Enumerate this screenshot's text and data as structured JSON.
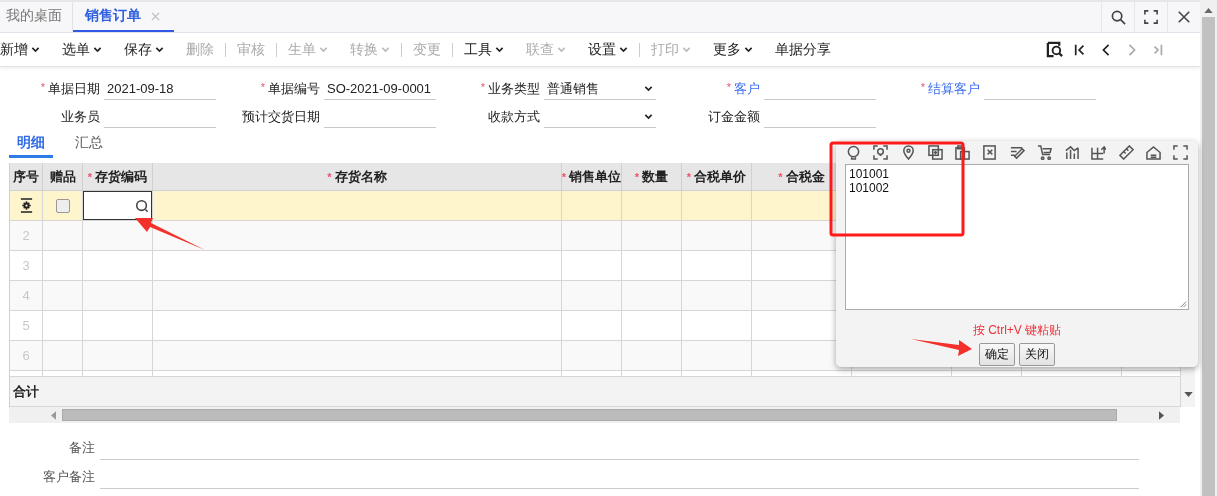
{
  "tabs": [
    {
      "label": "我的桌面",
      "selected": false
    },
    {
      "label": "销售订单",
      "selected": true
    }
  ],
  "toolbar": [
    {
      "label": "新增",
      "menu": true,
      "disabled": false,
      "sep_after": false
    },
    {
      "label": "选单",
      "menu": true,
      "disabled": false,
      "sep_after": false
    },
    {
      "label": "保存",
      "menu": true,
      "disabled": false,
      "sep_after": false
    },
    {
      "label": "删除",
      "menu": false,
      "disabled": true,
      "sep_after": true
    },
    {
      "label": "审核",
      "menu": false,
      "disabled": true,
      "sep_after": true
    },
    {
      "label": "生单",
      "menu": true,
      "disabled": true,
      "sep_after": false
    },
    {
      "label": "转换",
      "menu": true,
      "disabled": true,
      "sep_after": true
    },
    {
      "label": "变更",
      "menu": false,
      "disabled": true,
      "sep_after": true
    },
    {
      "label": "工具",
      "menu": true,
      "disabled": false,
      "sep_after": false
    },
    {
      "label": "联查",
      "menu": true,
      "disabled": true,
      "sep_after": false
    },
    {
      "label": "设置",
      "menu": true,
      "disabled": false,
      "sep_after": true
    },
    {
      "label": "打印",
      "menu": true,
      "disabled": true,
      "sep_after": false
    },
    {
      "label": "更多",
      "menu": true,
      "disabled": false,
      "sep_after": false
    },
    {
      "label": "单据分享",
      "menu": false,
      "disabled": false,
      "sep_after": false
    }
  ],
  "nav_buttons": [
    {
      "kind": "locate",
      "disabled": false
    },
    {
      "kind": "first",
      "disabled": false
    },
    {
      "kind": "prev",
      "disabled": false
    },
    {
      "kind": "next",
      "disabled": true
    },
    {
      "kind": "last",
      "disabled": true
    }
  ],
  "form_fields": [
    {
      "label": "单据日期",
      "required_mark": "*",
      "link": false,
      "kind": "text",
      "value": "2021-09-18"
    },
    {
      "label": "单据编号",
      "required_mark": "*",
      "link": false,
      "kind": "text",
      "value": "SO-2021-09-0001"
    },
    {
      "label": "业务类型",
      "required_mark": "*",
      "link": false,
      "kind": "select",
      "value": "普通销售"
    },
    {
      "label": "客户",
      "required_mark": "*",
      "link": true,
      "kind": "text"
    },
    {
      "label": "结算客户",
      "required_mark": "*",
      "link": true,
      "kind": "text"
    },
    {
      "label": "业务员",
      "link": false,
      "kind": "text"
    },
    {
      "label": "预计交货日期",
      "link": false,
      "kind": "text"
    },
    {
      "label": "收款方式",
      "link": false,
      "kind": "select"
    },
    {
      "label": "订金金额",
      "link": false,
      "kind": "text"
    }
  ],
  "sub_tabs": [
    {
      "label": "明细",
      "selected": true
    },
    {
      "label": "汇总",
      "selected": false
    }
  ],
  "table": {
    "columns": [
      {
        "label": "序号"
      },
      {
        "label": "赠品"
      },
      {
        "label": "存货编码",
        "required_mark": "*"
      },
      {
        "label": "存货名称",
        "required_mark": "*"
      },
      {
        "label": "销售单位",
        "required_mark": "*"
      },
      {
        "label": "数量",
        "required_mark": "*"
      },
      {
        "label": "合税单价",
        "required_mark": "*"
      },
      {
        "label": "合税金",
        "required_mark": "*"
      }
    ],
    "rows": [
      {
        "selected": true,
        "gift": false
      },
      {
        "no": "2",
        "selected": false
      },
      {
        "no": "3",
        "selected": false
      },
      {
        "no": "4",
        "selected": false
      },
      {
        "no": "5",
        "selected": false
      },
      {
        "no": "6",
        "selected": false
      }
    ],
    "total_label": "合计"
  },
  "remarks": [
    {
      "label": "备注"
    },
    {
      "label": "客户备注"
    }
  ],
  "paste_popup": {
    "lines": [
      "101001",
      "101002"
    ],
    "hint": "按 Ctrl+V 键粘贴",
    "buttons": [
      "确定",
      "关闭"
    ]
  }
}
